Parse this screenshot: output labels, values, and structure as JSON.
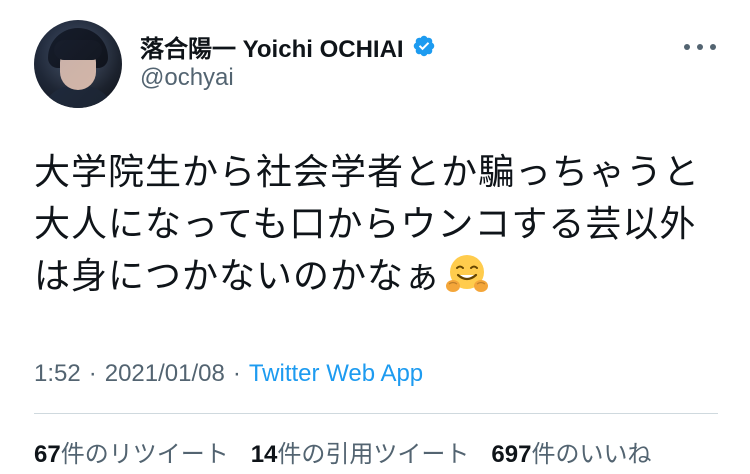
{
  "author": {
    "display_name": "落合陽一 Yoichi OCHIAI",
    "handle": "@ochyai",
    "verified": true,
    "avatar_icon": "profile-photo"
  },
  "tweet": {
    "lines": [
      "大学院生から社会学者とか騙っちゃうと",
      "大人になっても口からウンコする芸以外",
      "は身につかないのかなぁ"
    ],
    "emoji": "hugging-face-emoji"
  },
  "meta": {
    "time": "1:52",
    "separator": "·",
    "date": "2021/01/08",
    "source": "Twitter Web App"
  },
  "stats": [
    {
      "count": "67",
      "label": "件のリツイート"
    },
    {
      "count": "14",
      "label": "件の引用ツイート"
    },
    {
      "count": "697",
      "label": "件のいいね"
    }
  ],
  "colors": {
    "text_primary": "#0f1419",
    "text_secondary": "#536471",
    "link": "#1d9bf0",
    "verified": "#1d9bf0",
    "divider": "#cfd9de"
  }
}
